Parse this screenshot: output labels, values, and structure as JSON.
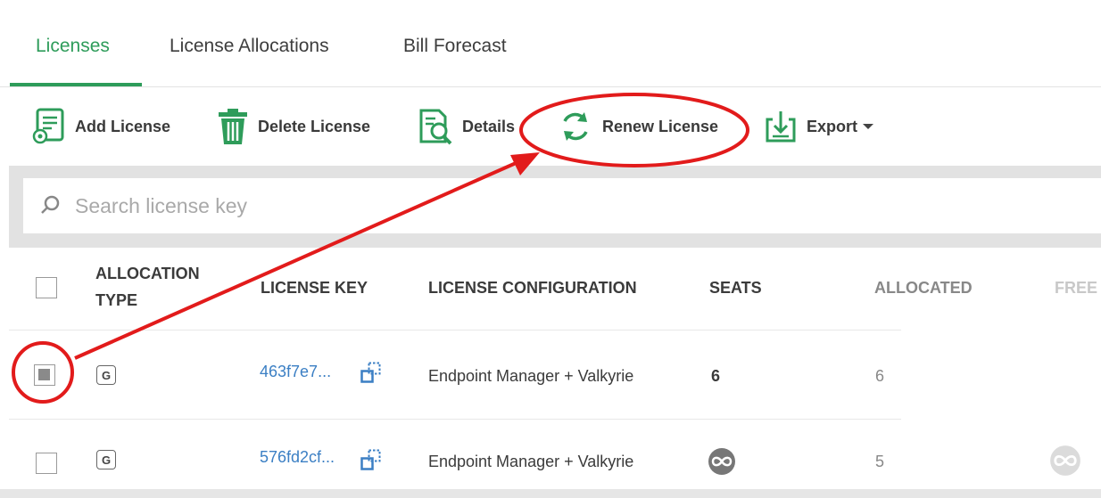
{
  "tabs": [
    {
      "label": "Licenses",
      "active": true
    },
    {
      "label": "License Allocations",
      "active": false
    },
    {
      "label": "Bill Forecast",
      "active": false
    }
  ],
  "toolbar": {
    "add_label": "Add License",
    "delete_label": "Delete License",
    "details_label": "Details",
    "renew_label": "Renew License",
    "export_label": "Export"
  },
  "search": {
    "placeholder": "Search license key"
  },
  "table": {
    "headers": {
      "allocation_type_line1": "ALLOCATION",
      "allocation_type_line2": "TYPE",
      "license_key": "LICENSE KEY",
      "license_configuration": "LICENSE CONFIGURATION",
      "seats": "SEATS",
      "allocated": "ALLOCATED",
      "free": "FREE"
    },
    "rows": [
      {
        "checked": true,
        "allocation_type": "G",
        "license_key": "463f7e7...",
        "configuration": "Endpoint Manager + Valkyrie",
        "seats": "6",
        "allocated": "6"
      },
      {
        "checked": false,
        "allocation_type": "G",
        "license_key": "576fd2cf...",
        "configuration": "Endpoint Manager + Valkyrie",
        "seats": "unlimited-icon",
        "allocated": "5"
      }
    ]
  },
  "colors": {
    "accent": "#2e9c5a",
    "link": "#3b7fc4",
    "annotation": "#e21b1b"
  }
}
